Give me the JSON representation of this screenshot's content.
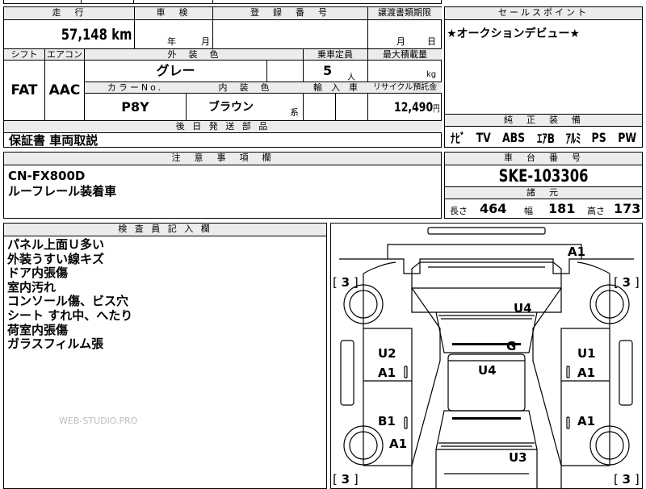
{
  "vehicle": {
    "headers": {
      "mileage": "走　行",
      "shaken": "車　検",
      "registration": "登　録　番　号",
      "transfer_deadline": "譲渡書類期限",
      "shift": "シフト",
      "aircon": "エアコン",
      "exterior_color": "外　装　色",
      "capacity": "乗車定員",
      "max_load": "最大積載量",
      "color_no": "カラーNo.",
      "interior_color": "内　装　色",
      "import": "輸　入　車",
      "recycle_fee": "リサイクル預託金",
      "later_parts": "後 日 発 送 部 品"
    },
    "mileage_value": "57,148",
    "mileage_unit": "km",
    "shaken_year": "年",
    "shaken_month": "月",
    "transfer_month": "月",
    "transfer_day": "日",
    "shift": "FAT",
    "aircon": "AAC",
    "exterior_color": "グレー",
    "capacity_value": "5",
    "capacity_unit": "人",
    "max_load_unit": "kg",
    "color_no": "P8Y",
    "interior_color": "ブラウン",
    "interior_suffix": "系",
    "recycle_value": "12,490",
    "recycle_unit": "円",
    "later_parts_value": "保証書 車両取説"
  },
  "sales": {
    "header": "セールスポイント",
    "text": "★オークションデビュー★",
    "equipment_header": "純　正　装　備",
    "equipment": [
      "ﾅﾋﾞ",
      "TV",
      "ABS",
      "ｴｱB",
      "ｱﾙﾐ",
      "PS",
      "PW"
    ]
  },
  "notes": {
    "header": "注　意　事　項　欄",
    "lines": [
      "CN-FX800D",
      "ルーフレール装着車"
    ]
  },
  "chassis": {
    "header": "車　台　番　号",
    "value": "SKE-103306"
  },
  "dims": {
    "header": "諸　元",
    "length_label": "長さ",
    "length": "464",
    "width_label": "幅",
    "width": "181",
    "height_label": "高さ",
    "height": "173"
  },
  "inspector": {
    "header": "検 査 員 記 入 欄",
    "lines": [
      "パネル上面Ｕ多い",
      "外装うすい線キズ",
      "ドア内張傷",
      "室内汚れ",
      "コンソール傷、ビス穴",
      "シート すれ中、へたり",
      "荷室内張傷",
      "ガラスフィルム張"
    ],
    "watermark": "WEB-STUDIO.PRO"
  },
  "diagram": {
    "marks": {
      "roof_top": "A1",
      "hood": "U4",
      "windshield": "G",
      "roof": "U4",
      "left_front_door_1": "U2",
      "left_front_door_2": "A1",
      "left_rear_door": "B1",
      "left_rear_quarter": "A1",
      "right_front_door_1": "U1",
      "right_front_door_2": "A1",
      "right_rear_door": "A1",
      "rear": "U3"
    },
    "tires": {
      "front_left": "3",
      "front_right": "3",
      "rear_left": "3",
      "rear_right": "3"
    }
  }
}
